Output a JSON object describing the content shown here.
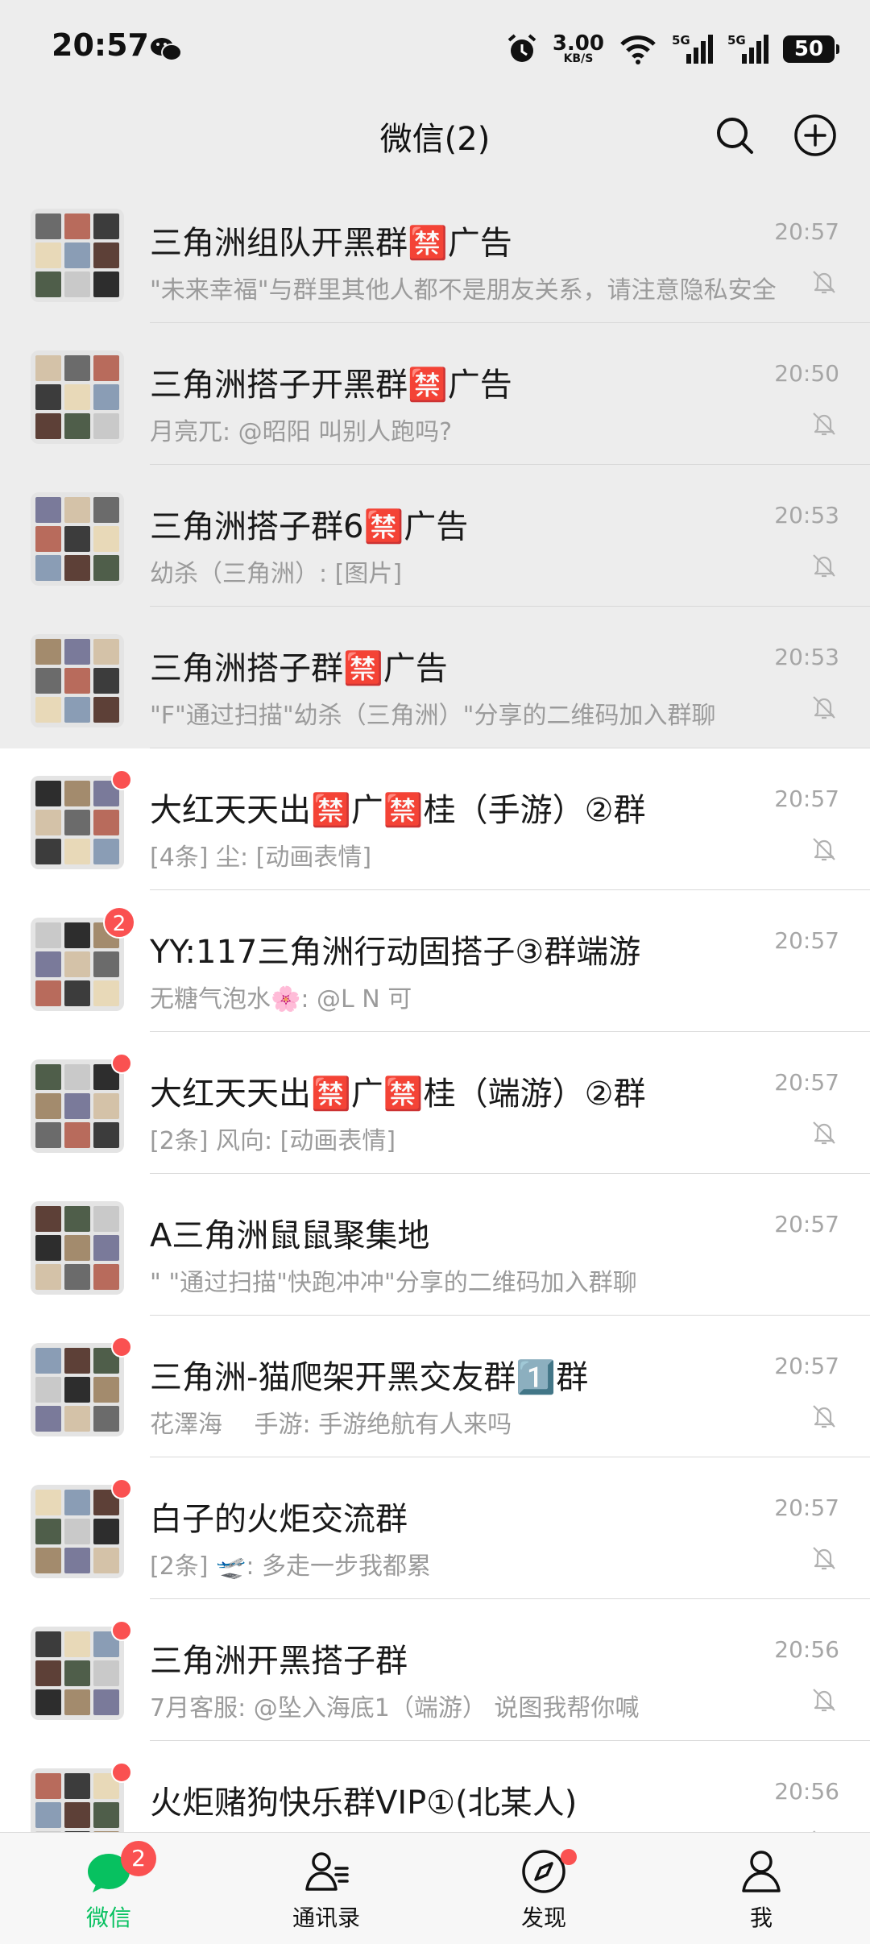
{
  "status_bar": {
    "time": "20:57",
    "net_speed_value": "3.00",
    "net_speed_unit": "KB/S",
    "signal1_label": "5G",
    "signal2_label": "5G",
    "battery": "50"
  },
  "header": {
    "title": "微信(2)"
  },
  "chats": [
    {
      "name": "三角洲组队开黑群🈲广告",
      "preview": "\"未来幸福\"与群里其他人都不是朋友关系，请注意隐私安全",
      "time": "20:57",
      "pinned": true,
      "muted": true
    },
    {
      "name": "三角洲搭子开黑群🈲广告",
      "preview": "月亮兀: @昭阳 叫别人跑吗?",
      "time": "20:50",
      "pinned": true,
      "muted": true
    },
    {
      "name": "三角洲搭子群6🈲广告",
      "preview": "幼杀（三角洲）: [图片]",
      "time": "20:53",
      "pinned": true,
      "muted": true
    },
    {
      "name": "三角洲搭子群🈲广告",
      "preview": "\"F\"通过扫描\"幼杀（三角洲）\"分享的二维码加入群聊",
      "time": "20:53",
      "pinned": true,
      "muted": true
    },
    {
      "name": "大红天天出🈲广🈲桂（手游）②群",
      "preview": "[4条] 尘: [动画表情]",
      "time": "20:57",
      "pinned": false,
      "muted": true,
      "dot": true
    },
    {
      "name": "YY:117三角洲行动固搭子③群端游",
      "preview": "无糖气泡水🌸: @L N 可",
      "time": "20:57",
      "pinned": false,
      "muted": false,
      "count": "2"
    },
    {
      "name": "大红天天出🈲广🈲桂（端游）②群",
      "preview": "[2条] 风向: [动画表情]",
      "time": "20:57",
      "pinned": false,
      "muted": true,
      "dot": true
    },
    {
      "name": "A三角洲鼠鼠聚集地",
      "preview": "\" \"通过扫描\"快跑冲冲\"分享的二维码加入群聊",
      "time": "20:57",
      "pinned": false,
      "muted": false
    },
    {
      "name": "三角洲-猫爬架开黑交友群1️⃣群",
      "preview": "花澤海　 手游: 手游绝航有人来吗",
      "time": "20:57",
      "pinned": false,
      "muted": true,
      "dot": true
    },
    {
      "name": "白子的火炬交流群",
      "preview": "[2条] 🛫: 多走一步我都累",
      "time": "20:57",
      "pinned": false,
      "muted": true,
      "dot": true
    },
    {
      "name": "三角洲开黑搭子群",
      "preview": "7月客服: @坠入海底1（端游） 说图我帮你喊",
      "time": "20:56",
      "pinned": false,
      "muted": true,
      "dot": true
    },
    {
      "name": "火炬赌狗快乐群VIP①(北某人)",
      "preview": "",
      "time": "20:56",
      "pinned": false,
      "muted": true,
      "dot": true
    }
  ],
  "tabs": [
    {
      "label": "微信",
      "icon": "chat-icon",
      "active": true,
      "badge": "2"
    },
    {
      "label": "通讯录",
      "icon": "contacts-icon",
      "active": false
    },
    {
      "label": "发现",
      "icon": "compass-icon",
      "active": false,
      "dot": true
    },
    {
      "label": "我",
      "icon": "person-icon",
      "active": false
    }
  ],
  "colors": {
    "accent": "#07c160",
    "badge": "#fa5151",
    "pinned_bg": "#ededed",
    "row_bg": "#ffffff"
  }
}
